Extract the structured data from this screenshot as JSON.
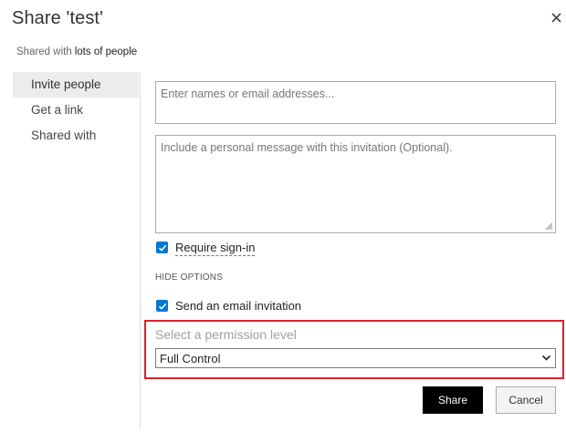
{
  "dialog": {
    "title": "Share 'test'",
    "close_icon": "close-icon"
  },
  "shared_with": {
    "prefix": "Shared with",
    "link": "lots of people"
  },
  "nav": {
    "items": [
      {
        "label": "Invite people",
        "active": true
      },
      {
        "label": "Get a link",
        "active": false
      },
      {
        "label": "Shared with",
        "active": false
      }
    ]
  },
  "form": {
    "names_placeholder": "Enter names or email addresses...",
    "message_placeholder": "Include a personal message with this invitation (Optional).",
    "require_signin": {
      "label": "Require sign-in",
      "checked": true
    },
    "hide_options_label": "HIDE OPTIONS",
    "send_email": {
      "label": "Send an email invitation",
      "checked": true
    },
    "permission": {
      "caption": "Select a permission level",
      "selected": "Full Control"
    }
  },
  "buttons": {
    "share": "Share",
    "cancel": "Cancel"
  },
  "colors": {
    "accent": "#0078d4",
    "highlight_border": "#e0202a",
    "primary_button": "#000000"
  }
}
